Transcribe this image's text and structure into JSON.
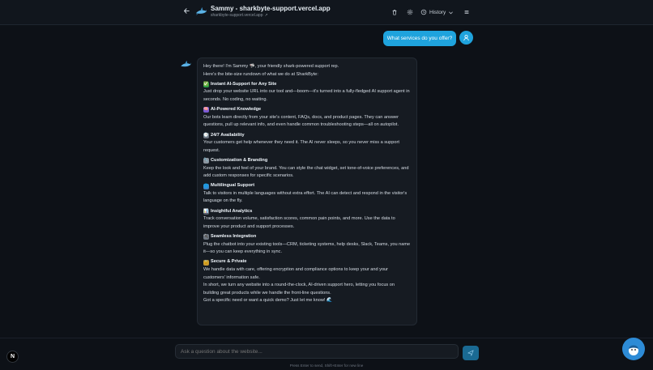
{
  "header": {
    "title": "Sammy - sharkbyte-support.vercel.app",
    "subtitle": "sharkbyte-support.vercel.app",
    "history_label": "History"
  },
  "icons": {
    "back": "arrow-left-icon",
    "logo": "shark-logo-icon",
    "trash": "trash-icon",
    "settings": "gear-icon",
    "history": "clock-history-icon",
    "menu": "menu-icon",
    "user": "user-icon",
    "send": "send-icon"
  },
  "chat": {
    "user_message": "What services do you offer?",
    "bot": {
      "intro_line1": "Hey there! I'm Sammy 🦈, your friendly shark-powered support rep.",
      "intro_line2": "Here's the bite-size rundown of what we do at SharkByte:",
      "sections": [
        {
          "emoji": "✅",
          "title": "Instant AI-Support for Any Site",
          "body": "Just drop your website URL into our tool and—boom—it's turned into a fully-fledged AI support agent in seconds. No coding, no waiting."
        },
        {
          "emoji": "🧠",
          "title": "AI-Powered Knowledge",
          "body": "Our bots learn directly from your site's content, FAQs, docs, and product pages. They can answer questions, pull up relevant info, and even handle common troubleshooting steps—all on autopilot."
        },
        {
          "emoji": "🕒",
          "title": "24/7 Availability",
          "body": "Your customers get help whenever they need it. The AI never sleeps, so you never miss a support request."
        },
        {
          "emoji": "🔧",
          "title": "Customization & Branding",
          "body": "Keep the look and feel of your brand. You can style the chat widget, set tone-of-voice preferences, and add custom responses for specific scenarios."
        },
        {
          "emoji": "🌐",
          "title": "Multilingual Support",
          "body": "Talk to visitors in multiple languages without extra effort. The AI can detect and respond in the visitor's language on the fly."
        },
        {
          "emoji": "📊",
          "title": "Insightful Analytics",
          "body": "Track conversation volume, satisfaction scores, common pain points, and more. Use the data to improve your product and support processes."
        },
        {
          "emoji": "🔌",
          "title": "Seamless Integration",
          "body": "Plug the chatbot into your existing tools—CRM, ticketing systems, help desks, Slack, Teams, you name it—so you can keep everything in sync."
        },
        {
          "emoji": "🔒",
          "title": "Secure & Private",
          "body": "We handle data with care, offering encryption and compliance options to keep your and your customers' information safe."
        }
      ],
      "closing": "In short, we turn any website into a round-the-clock, AI-driven support hero, letting you focus on building great products while we handle the front-line questions.",
      "final": "Got a specific need or want a quick demo? Just let me know! 🌊"
    }
  },
  "composer": {
    "placeholder": "Ask a question about the website...",
    "hint": "Press Enter to send, Shift+Enter for new line"
  },
  "badge_letter": "N",
  "colors": {
    "accent": "#1fa3dd",
    "background": "#0d1117",
    "card": "#161b22"
  }
}
